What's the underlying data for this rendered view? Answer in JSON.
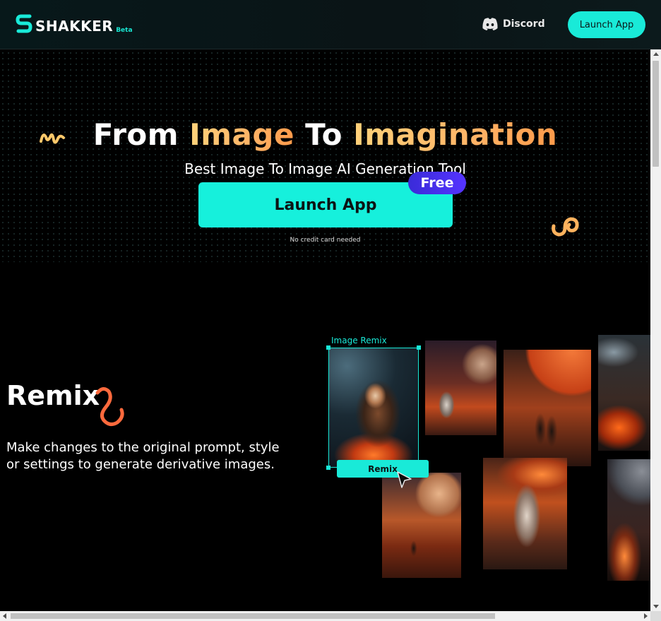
{
  "header": {
    "logo_text": "SHAKKER",
    "logo_badge": "Beta",
    "discord_label": "Discord",
    "launch_label": "Launch App"
  },
  "hero": {
    "title_part1": "From ",
    "title_hl1": "Image",
    "title_part2": " To ",
    "title_hl2": "Imagination",
    "subtitle": "Best Image To Image AI Generation Tool",
    "cta_label": "Launch App",
    "free_badge": "Free",
    "note": "No credit card needed"
  },
  "remix": {
    "title": "Remix",
    "description": "Make changes to the original prompt, style or settings to generate derivative images.",
    "frame_label": "Image Remix",
    "button_label": "Remix"
  },
  "colors": {
    "accent": "#19ead8",
    "title_gradient_start": "#ffd27a",
    "title_gradient_end": "#ff9a4a",
    "badge": "#4a30f0"
  },
  "icons": {
    "logo": "shakker-s-logo-icon",
    "discord": "discord-icon",
    "cursor": "mouse-pointer-icon"
  }
}
